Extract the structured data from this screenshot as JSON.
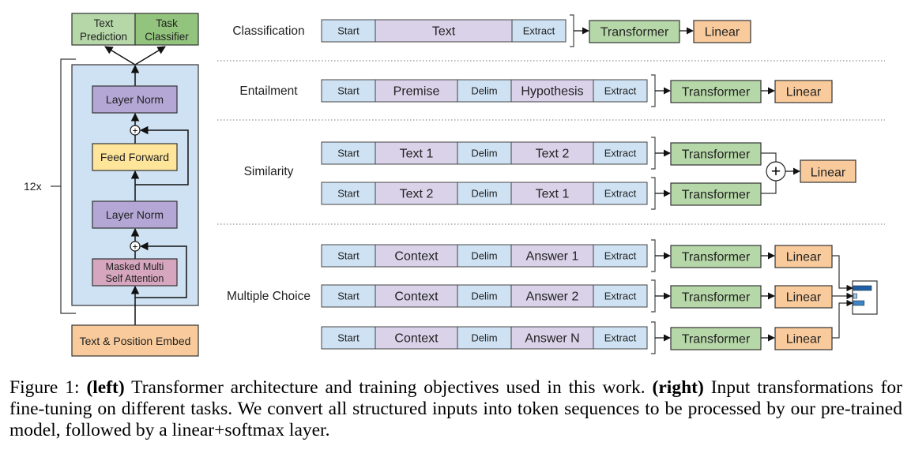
{
  "figure": {
    "left_panel": {
      "outputs": [
        "Text Prediction",
        "Task Classifier"
      ],
      "outputs_lines": [
        [
          "Text",
          "Prediction"
        ],
        [
          "Task",
          "Classifier"
        ]
      ],
      "repeat_label": "12x",
      "blocks": {
        "layer_norm_top": "Layer Norm",
        "feed_forward": "Feed Forward",
        "layer_norm_bottom": "Layer Norm",
        "attention_lines": [
          "Masked Multi",
          "Self Attention"
        ],
        "embed": "Text & Position Embed"
      },
      "plus_symbol": "+"
    },
    "tasks": [
      {
        "name": "Classification",
        "rows": [
          {
            "tokens": [
              "Start",
              "Text",
              "Extract"
            ],
            "head": [
              "Transformer",
              "Linear"
            ]
          }
        ]
      },
      {
        "name": "Entailment",
        "rows": [
          {
            "tokens": [
              "Start",
              "Premise",
              "Delim",
              "Hypothesis",
              "Extract"
            ],
            "head": [
              "Transformer",
              "Linear"
            ]
          }
        ]
      },
      {
        "name": "Similarity",
        "rows": [
          {
            "tokens": [
              "Start",
              "Text 1",
              "Delim",
              "Text 2",
              "Extract"
            ],
            "head": [
              "Transformer"
            ]
          },
          {
            "tokens": [
              "Start",
              "Text 2",
              "Delim",
              "Text 1",
              "Extract"
            ],
            "head": [
              "Transformer"
            ]
          }
        ],
        "combine": {
          "symbol": "+",
          "output": "Linear"
        }
      },
      {
        "name": "Multiple Choice",
        "rows": [
          {
            "tokens": [
              "Start",
              "Context",
              "Delim",
              "Answer 1",
              "Extract"
            ],
            "head": [
              "Transformer",
              "Linear"
            ]
          },
          {
            "tokens": [
              "Start",
              "Context",
              "Delim",
              "Answer 2",
              "Extract"
            ],
            "head": [
              "Transformer",
              "Linear"
            ]
          },
          {
            "tokens": [
              "Start",
              "Context",
              "Delim",
              "Answer N",
              "Extract"
            ],
            "head": [
              "Transformer",
              "Linear"
            ]
          }
        ],
        "softmax_bars": [
          1.0,
          0.2,
          0.6
        ]
      }
    ],
    "colors": {
      "special_token": "#cfe2f3",
      "content_token": "#d9d2e9",
      "transformer": "#b6d7a8",
      "linear": "#f9cb9c",
      "layer_norm": "#b4a7d6",
      "feed_forward": "#ffe599",
      "attention": "#d5a6bd",
      "block_bg": "#cfe2f3",
      "text_prediction": "#b6d7a8",
      "task_classifier": "#93c47d",
      "softmax_dark": "#1f5fa6",
      "softmax_light": "#9fc5e8",
      "softmax_mid": "#3d85c6"
    }
  },
  "caption": {
    "prefix": "Figure 1: ",
    "left_bold": "(left)",
    "left_text": " Transformer architecture and training objectives used in this work. ",
    "right_bold": "(right)",
    "right_text": " Input transformations for fine-tuning on different tasks.  We convert all structured inputs into token sequences to be processed by our pre-trained model, followed by a linear+softmax layer."
  }
}
